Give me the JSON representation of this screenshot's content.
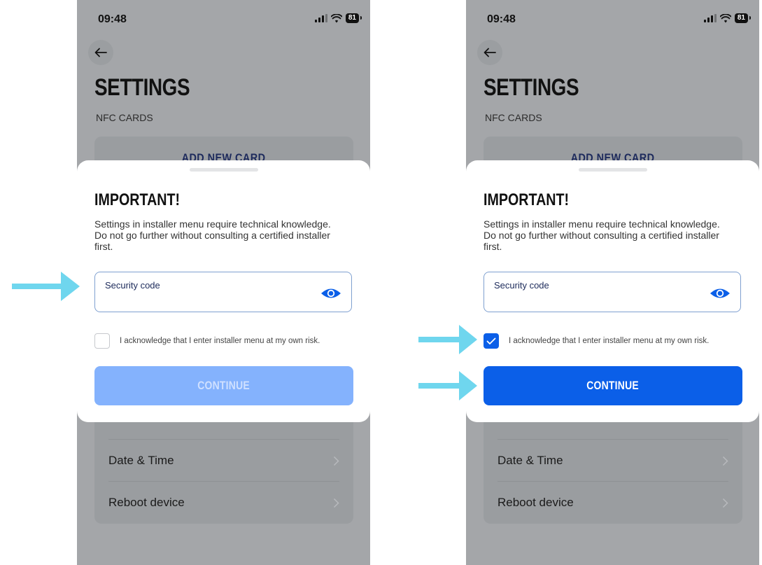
{
  "left": {
    "status": {
      "time": "09:48",
      "battery": "81"
    },
    "title": "SETTINGS",
    "section_label": "NFC CARDS",
    "add_card_label": "ADD NEW CARD",
    "dialog": {
      "title": "IMPORTANT!",
      "body": "Settings in installer menu require technical knowledge. Do not go further without consulting a certified installer first.",
      "security_label": "Security code",
      "ack_text": "I acknowledge that I enter installer menu at my own risk.",
      "ack_checked": false,
      "continue_label": "CONTINUE",
      "continue_enabled": false
    },
    "list": [
      {
        "label": ""
      },
      {
        "label": "Date & Time"
      },
      {
        "label": "Reboot device"
      }
    ]
  },
  "right": {
    "status": {
      "time": "09:48",
      "battery": "81"
    },
    "title": "SETTINGS",
    "section_label": "NFC CARDS",
    "add_card_label": "ADD NEW CARD",
    "dialog": {
      "title": "IMPORTANT!",
      "body": "Settings in installer menu require technical knowledge. Do not go further without consulting a certified installer first.",
      "security_label": "Security code",
      "ack_text": "I acknowledge that I enter installer menu at my own risk.",
      "ack_checked": true,
      "continue_label": "CONTINUE",
      "continue_enabled": true
    },
    "list": [
      {
        "label": ""
      },
      {
        "label": "Date & Time"
      },
      {
        "label": "Reboot device"
      }
    ]
  },
  "colors": {
    "primary_blue": "#0b5fe8",
    "disabled_blue": "#84b2fd",
    "arrow": "#6fd6ee",
    "overlay_gray": "#a4a6a9"
  },
  "icons": [
    "back-arrow-icon",
    "eye-icon",
    "chevron-right-icon",
    "check-icon",
    "signal-icon",
    "wifi-icon",
    "battery-icon"
  ]
}
